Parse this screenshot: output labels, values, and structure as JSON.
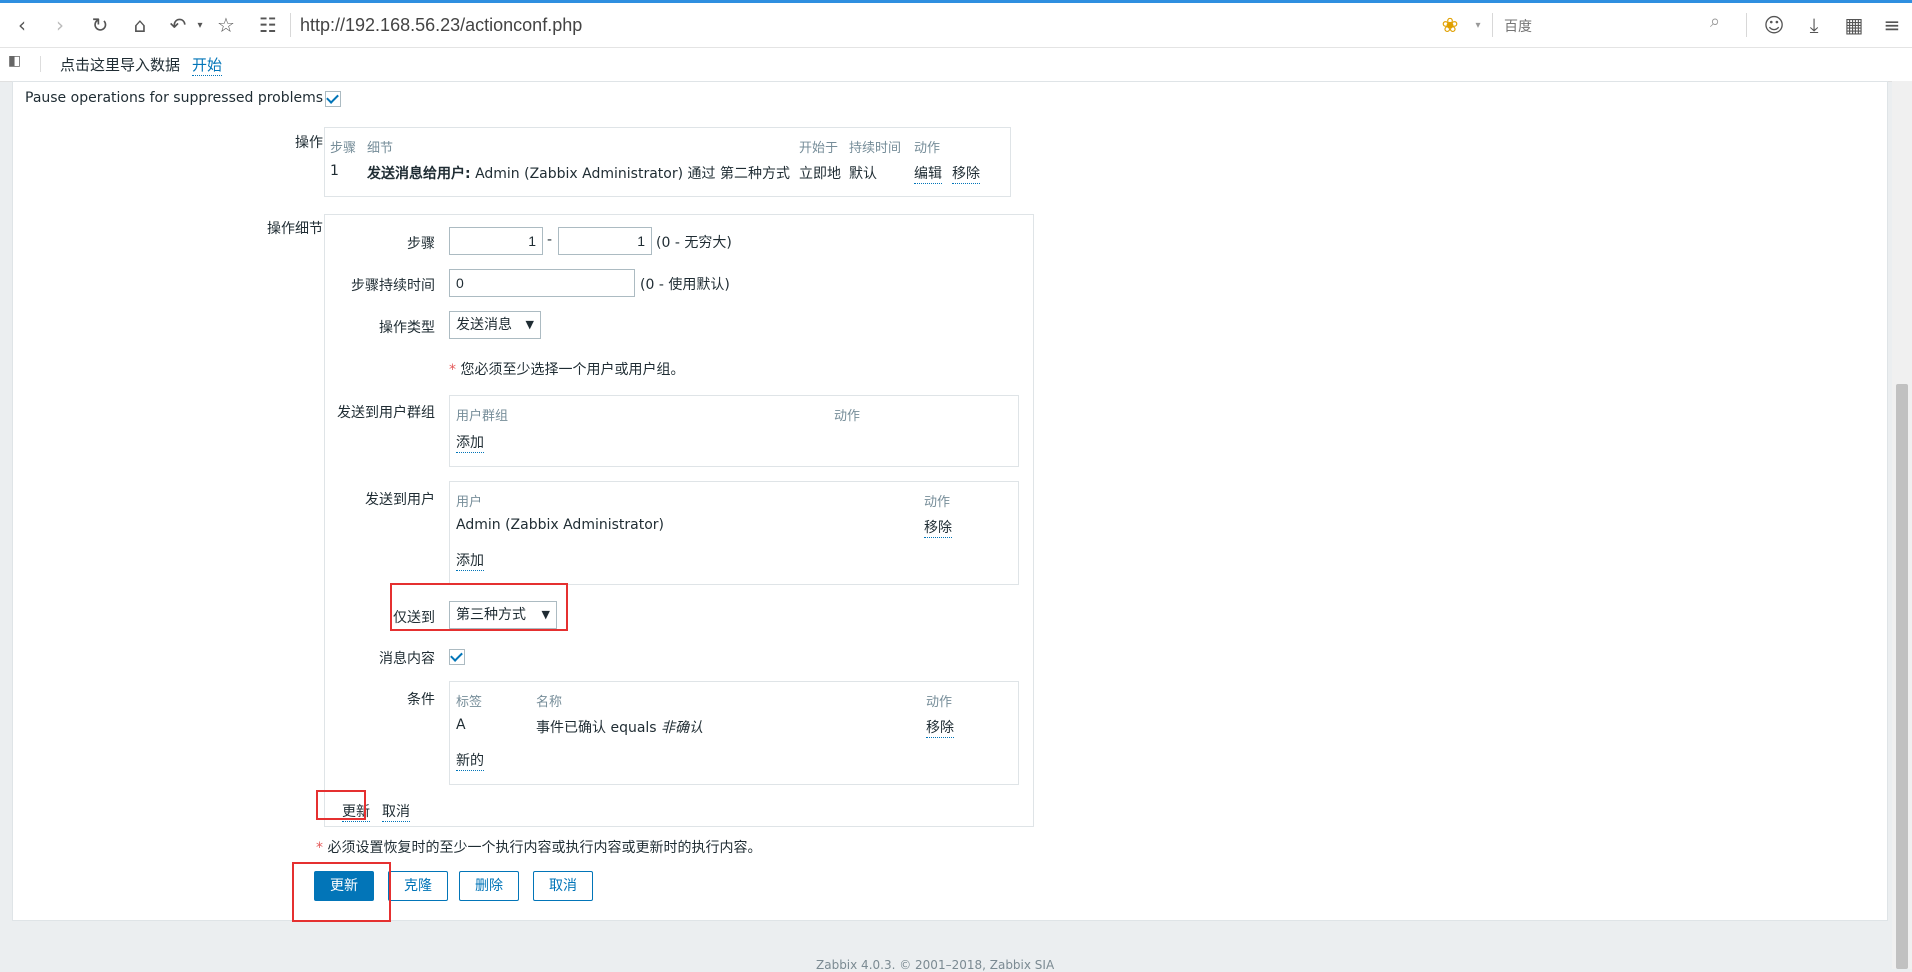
{
  "browser": {
    "url": "http://192.168.56.23/actionconf.php",
    "search_placeholder": "百度",
    "bookmark_text": "点击这里导入数据",
    "bookmark_link": "开始"
  },
  "form": {
    "pause_label": "Pause operations for suppressed problems",
    "pause_checked": true,
    "operations": {
      "label": "操作",
      "headers": {
        "steps": "步骤",
        "details": "细节",
        "start_in": "开始于",
        "duration": "持续时间",
        "action": "动作"
      },
      "rows": [
        {
          "step": "1",
          "detail_bold": "发送消息给用户:",
          "detail_rest": "Admin (Zabbix Administrator) 通过 第二种方式",
          "start_in": "立即地",
          "duration": "默认",
          "edit": "编辑",
          "remove": "移除"
        }
      ]
    },
    "op_details": {
      "label": "操作细节",
      "steps_label": "步骤",
      "steps_from": "1",
      "steps_dash": "-",
      "steps_to": "1",
      "steps_hint": "(0 - 无穷大)",
      "duration_label": "步骤持续时间",
      "duration_value": "0",
      "duration_hint": "(0 - 使用默认)",
      "op_type_label": "操作类型",
      "op_type_value": "发送消息",
      "required_star": "*",
      "required_note": "您必须至少选择一个用户或用户组。",
      "user_groups": {
        "label": "发送到用户群组",
        "col_group": "用户群组",
        "col_action": "动作",
        "add": "添加"
      },
      "users": {
        "label": "发送到用户",
        "col_user": "用户",
        "col_action": "动作",
        "rows": [
          {
            "user": "Admin (Zabbix Administrator)",
            "remove": "移除"
          }
        ],
        "add": "添加"
      },
      "send_only_label": "仅送到",
      "send_only_value": "第三种方式",
      "default_message_label": "消息内容",
      "default_message_checked": true,
      "conditions": {
        "label": "条件",
        "col_label": "标签",
        "col_name": "名称",
        "col_action": "动作",
        "rows": [
          {
            "label": "A",
            "name": "事件已确认 equals",
            "value": "非确认",
            "remove": "移除"
          }
        ],
        "new": "新的"
      },
      "update_link": "更新",
      "cancel_link": "取消"
    },
    "recovery_note": "必须设置恢复时的至少一个执行内容或执行内容或更新时的执行内容。",
    "buttons": {
      "update": "更新",
      "clone": "克隆",
      "delete": "删除",
      "cancel": "取消"
    }
  },
  "footer": "Zabbix 4.0.3. © 2001–2018, Zabbix SIA"
}
